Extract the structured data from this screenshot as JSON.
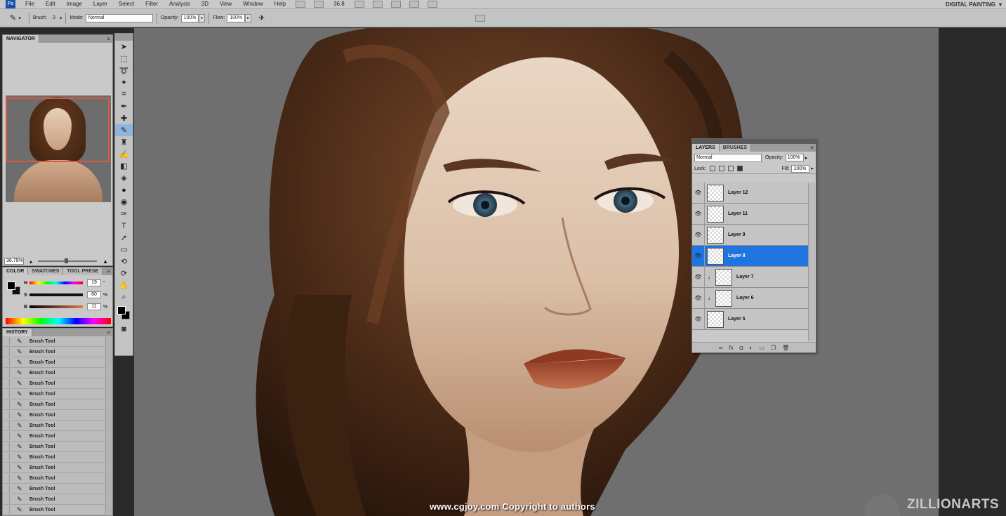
{
  "menubar": {
    "logo": "Ps",
    "items": [
      "File",
      "Edit",
      "Image",
      "Layer",
      "Select",
      "Filter",
      "Analysis",
      "3D",
      "View",
      "Window",
      "Help"
    ],
    "zoom": "36.8",
    "workspace": "DIGITAL PAINTING"
  },
  "options": {
    "brush_label": "Brush:",
    "brush_size": "3",
    "mode_label": "Mode:",
    "mode_value": "Normal",
    "opacity_label": "Opacity:",
    "opacity_value": "100%",
    "flow_label": "Flow:",
    "flow_value": "100%"
  },
  "navigator": {
    "tab": "NAVIGATOR",
    "zoom": "36.79%",
    "view_box_color": "#e2553b"
  },
  "color_panel": {
    "tabs": [
      "COLOR",
      "SWATCHES",
      "TOOL PRESE"
    ],
    "h_label": "H",
    "s_label": "S",
    "b_label": "B",
    "h_value": "19",
    "s_value": "60",
    "b_value": "11",
    "h_unit": "°",
    "s_unit": "%",
    "b_unit": "%"
  },
  "history": {
    "tab": "HISTORY",
    "items": [
      "Brush Tool",
      "Brush Tool",
      "Brush Tool",
      "Brush Tool",
      "Brush Tool",
      "Brush Tool",
      "Brush Tool",
      "Brush Tool",
      "Brush Tool",
      "Brush Tool",
      "Brush Tool",
      "Brush Tool",
      "Brush Tool",
      "Brush Tool",
      "Brush Tool",
      "Brush Tool",
      "Brush Tool"
    ]
  },
  "layers_panel": {
    "tabs": [
      "LAYERS",
      "BRUSHES"
    ],
    "blend_mode": "Normal",
    "opacity_label": "Opacity:",
    "opacity_value": "100%",
    "lock_label": "Lock:",
    "fill_label": "Fill:",
    "fill_value": "100%",
    "layers": [
      {
        "name": "Layer 12",
        "clipped": false,
        "selected": false
      },
      {
        "name": "Layer 11",
        "clipped": false,
        "selected": false
      },
      {
        "name": "Layer 9",
        "clipped": false,
        "selected": false
      },
      {
        "name": "Layer 8",
        "clipped": false,
        "selected": true
      },
      {
        "name": "Layer 7",
        "clipped": true,
        "selected": false
      },
      {
        "name": "Layer 6",
        "clipped": true,
        "selected": false
      },
      {
        "name": "Layer 5",
        "clipped": false,
        "selected": false
      }
    ],
    "selected_color": "#1f74e0"
  },
  "overlay": {
    "watermark": "www.cgjoy.com Copyright to authors",
    "brand": "ZILLIONARTS"
  }
}
